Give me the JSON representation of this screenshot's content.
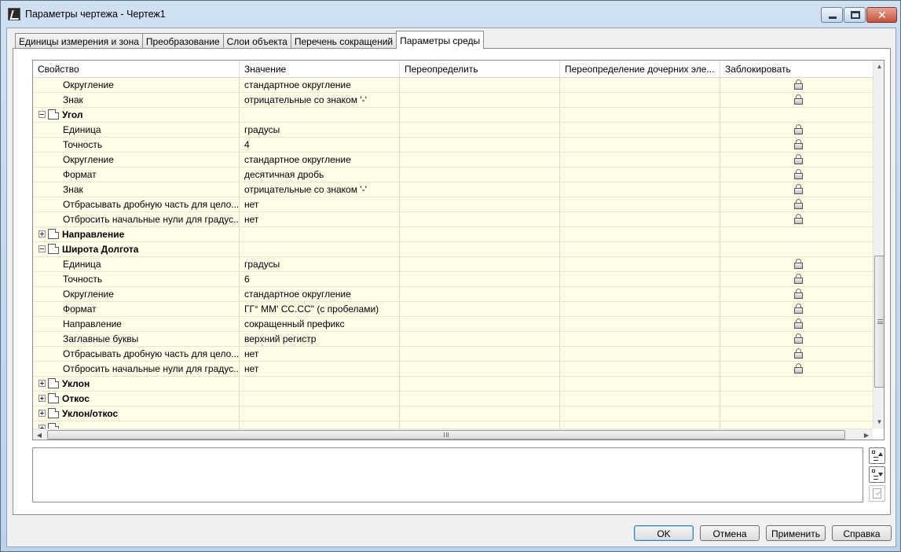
{
  "window": {
    "title": "Параметры чертежа - Чертеж1",
    "controls": {
      "minimize": "minimize-icon",
      "maximize": "maximize-icon",
      "close": "✕"
    }
  },
  "tabs": [
    {
      "label": "Единицы измерения и зона",
      "active": false
    },
    {
      "label": "Преобразование",
      "active": false
    },
    {
      "label": "Слои объекта",
      "active": false
    },
    {
      "label": "Перечень сокращений",
      "active": false
    },
    {
      "label": "Параметры среды",
      "active": true
    }
  ],
  "grid": {
    "columns": [
      "Свойство",
      "Значение",
      "Переопределить",
      "Переопределение дочерних эле...",
      "Заблокировать"
    ],
    "rows": [
      {
        "type": "item",
        "property": "Округление",
        "value": "стандартное округление",
        "locked": true
      },
      {
        "type": "item",
        "property": "Знак",
        "value": "отрицательные со знаком '-'",
        "locked": true
      },
      {
        "type": "group",
        "property": "Угол",
        "expanded": true
      },
      {
        "type": "item",
        "property": "Единица",
        "value": "градусы",
        "locked": true
      },
      {
        "type": "item",
        "property": "Точность",
        "value": "4",
        "locked": true
      },
      {
        "type": "item",
        "property": "Округление",
        "value": "стандартное округление",
        "locked": true
      },
      {
        "type": "item",
        "property": "Формат",
        "value": "десятичная дробь",
        "locked": true
      },
      {
        "type": "item",
        "property": "Знак",
        "value": "отрицательные со знаком '-'",
        "locked": true
      },
      {
        "type": "item",
        "property": "Отбрасывать дробную часть для цело...",
        "value": "нет",
        "locked": true
      },
      {
        "type": "item",
        "property": "Отбросить начальные нули для градус...",
        "value": "нет",
        "locked": true
      },
      {
        "type": "group",
        "property": "Направление",
        "expanded": false
      },
      {
        "type": "group",
        "property": "Широта Долгота",
        "expanded": true
      },
      {
        "type": "item",
        "property": "Единица",
        "value": "градусы",
        "locked": true
      },
      {
        "type": "item",
        "property": "Точность",
        "value": "6",
        "locked": true
      },
      {
        "type": "item",
        "property": "Округление",
        "value": "стандартное округление",
        "locked": true
      },
      {
        "type": "item",
        "property": "Формат",
        "value": "ГГ° ММ' СС.СС\" (с пробелами)",
        "locked": true
      },
      {
        "type": "item",
        "property": "Направление",
        "value": "сокращенный префикс",
        "locked": true
      },
      {
        "type": "item",
        "property": "Заглавные буквы",
        "value": "верхний регистр",
        "locked": true
      },
      {
        "type": "item",
        "property": "Отбрасывать дробную часть для цело...",
        "value": "нет",
        "locked": true
      },
      {
        "type": "item",
        "property": "Отбросить начальные нули для градус...",
        "value": "нет",
        "locked": true
      },
      {
        "type": "group",
        "property": "Уклон",
        "expanded": false
      },
      {
        "type": "group",
        "property": "Откос",
        "expanded": false
      },
      {
        "type": "group",
        "property": "Уклон/откос",
        "expanded": false
      },
      {
        "type": "group",
        "property": "",
        "expanded": false
      }
    ]
  },
  "scrollbars": {
    "hgrip": "III"
  },
  "buttons": {
    "ok": "OK",
    "cancel": "Отмена",
    "apply": "Применить",
    "help": "Справка"
  },
  "colors": {
    "row_bg": "#fefde8",
    "accent": "#3c7fb1"
  }
}
